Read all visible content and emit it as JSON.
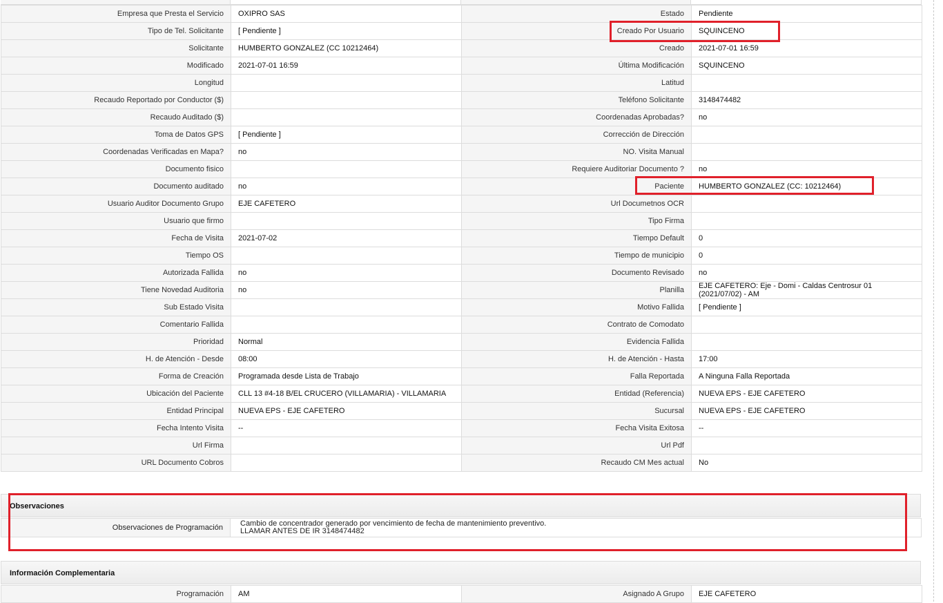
{
  "rows": [
    {
      "l1": "Empresa que Presta el Servicio",
      "v1": "OXIPRO SAS",
      "l2": "Estado",
      "v2": "Pendiente"
    },
    {
      "l1": "Tipo de Tel. Solicitante",
      "v1": "[ Pendiente ]",
      "l2": "Creado Por Usuario",
      "v2": "SQUINCENO"
    },
    {
      "l1": "Solicitante",
      "v1": "HUMBERTO GONZALEZ (CC 10212464)",
      "l2": "Creado",
      "v2": "2021-07-01 16:59"
    },
    {
      "l1": "Modificado",
      "v1": "2021-07-01 16:59",
      "l2": "Última Modificación",
      "v2": " SQUINCENO"
    },
    {
      "l1": "Longitud",
      "v1": "",
      "l2": "Latitud",
      "v2": ""
    },
    {
      "l1": "Recaudo Reportado por Conductor ($)",
      "v1": "",
      "l2": "Teléfono Solicitante",
      "v2": "3148474482"
    },
    {
      "l1": "Recaudo Auditado ($)",
      "v1": "",
      "l2": "Coordenadas Aprobadas?",
      "v2": " no"
    },
    {
      "l1": "Toma de Datos GPS",
      "v1": "[ Pendiente ]",
      "l2": "Corrección de Dirección",
      "v2": ""
    },
    {
      "l1": "Coordenadas Verificadas en Mapa?",
      "v1": " no",
      "l2": "NO. Visita Manual",
      "v2": ""
    },
    {
      "l1": "Documento fisico",
      "v1": "",
      "l2": "Requiere Auditoriar Documento ?",
      "v2": " no"
    },
    {
      "l1": "Documento auditado",
      "v1": " no",
      "l2": "Paciente",
      "v2": "HUMBERTO GONZALEZ (CC: 10212464)"
    },
    {
      "l1": "Usuario Auditor Documento Grupo",
      "v1": "EJE CAFETERO",
      "l2": "Url Documetnos OCR",
      "v2": ""
    },
    {
      "l1": "Usuario que firmo",
      "v1": "",
      "l2": "Tipo Firma",
      "v2": ""
    },
    {
      "l1": "Fecha de Visita",
      "v1": " 2021-07-02",
      "l2": "Tiempo Default",
      "v2": "0"
    },
    {
      "l1": "Tiempo OS",
      "v1": "",
      "l2": "Tiempo de municipio",
      "v2": "0"
    },
    {
      "l1": "Autorizada Fallida",
      "v1": " no",
      "l2": "Documento Revisado",
      "v2": " no"
    },
    {
      "l1": "Tiene Novedad Auditoria",
      "v1": " no",
      "l2": "Planilla",
      "v2": "EJE CAFETERO: Eje - Domi - Caldas Centrosur 01 (2021/07/02) - AM"
    },
    {
      "l1": "Sub Estado Visita",
      "v1": "",
      "l2": "Motivo Fallida",
      "v2": "[ Pendiente ]"
    },
    {
      "l1": "Comentario Fallida",
      "v1": "",
      "l2": "Contrato de Comodato",
      "v2": ""
    },
    {
      "l1": "Prioridad",
      "v1": "Normal",
      "l2": "Evidencia Fallida",
      "v2": ""
    },
    {
      "l1": "H. de Atención - Desde",
      "v1": "08:00",
      "l2": "H. de Atención - Hasta",
      "v2": "17:00"
    },
    {
      "l1": "Forma de Creación",
      "v1": "Programada desde Lista de Trabajo",
      "l2": "Falla Reportada",
      "v2": "A Ninguna Falla Reportada"
    },
    {
      "l1": "Ubicación del Paciente",
      "v1": "CLL 13 #4-18 B/EL CRUCERO (VILLAMARIA) - VILLAMARIA",
      "l2": "Entidad (Referencia)",
      "v2": "NUEVA EPS - EJE CAFETERO"
    },
    {
      "l1": "Entidad Principal",
      "v1": "NUEVA EPS - EJE CAFETERO",
      "l2": "Sucursal",
      "v2": "NUEVA EPS - EJE CAFETERO"
    },
    {
      "l1": "Fecha Intento Visita",
      "v1": " --",
      "l2": "Fecha Visita Exitosa",
      "v2": " --"
    },
    {
      "l1": "Url Firma",
      "v1": "",
      "l2": "Url Pdf",
      "v2": ""
    },
    {
      "l1": "URL Documento Cobros",
      "v1": "",
      "l2": "Recaudo CM Mes actual",
      "v2": "No"
    }
  ],
  "observaciones": {
    "title": "Observaciones",
    "label": "Observaciones de Programación",
    "line1": "Cambio de concentrador generado por vencimiento de fecha de mantenimiento preventivo.",
    "line2": "LLAMAR ANTES DE IR 3148474482"
  },
  "info_complementaria": {
    "title": "Información Complementaria",
    "row": {
      "l1": "Programación",
      "v1": "AM",
      "l2": "Asignado A Grupo",
      "v2": "EJE CAFETERO"
    }
  },
  "colors": {
    "highlight": "#e0202a",
    "label_bg": "#f5f5f5",
    "border": "#dcdcdc"
  }
}
